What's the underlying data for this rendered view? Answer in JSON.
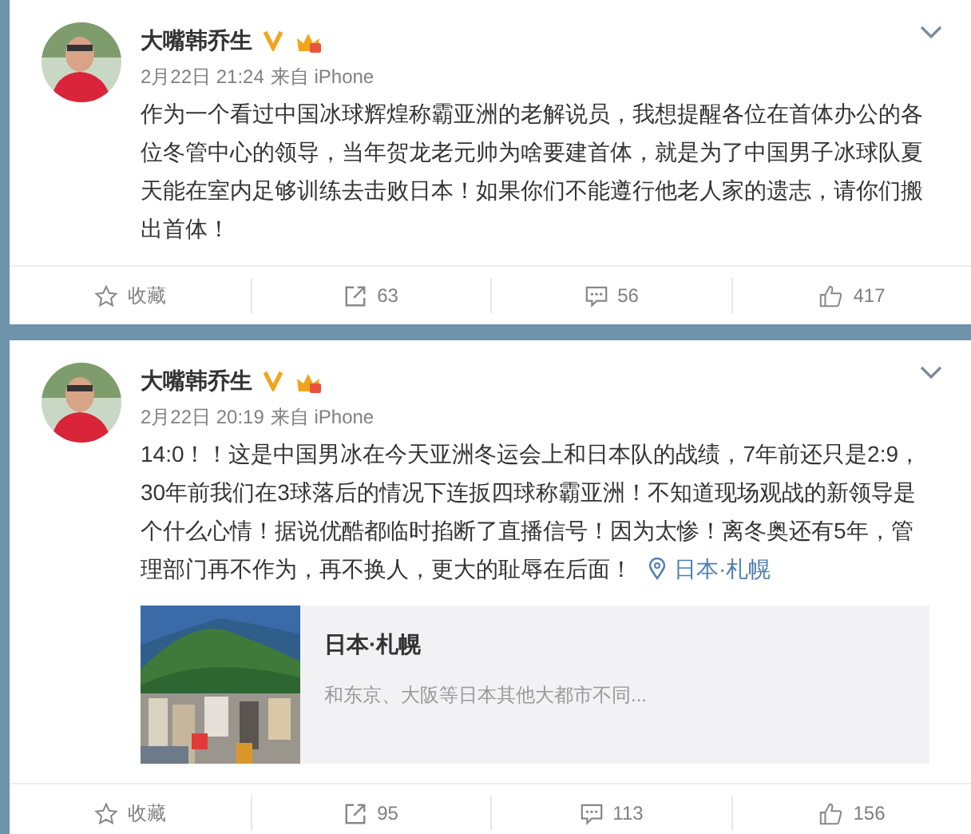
{
  "posts": [
    {
      "author": "大嘴韩乔生",
      "verified": true,
      "time": "2月22日 21:24",
      "source": "来自 iPhone",
      "text": "作为一个看过中国冰球辉煌称霸亚洲的老解说员，我想提醒各位在首体办公的各位冬管中心的领导，当年贺龙老元帅为啥要建首体，就是为了中国男子冰球队夏天能在室内足够训练去击败日本！如果你们不能遵行他老人家的遗志，请你们搬出首体！",
      "actions": {
        "favorite": "收藏",
        "reposts": "63",
        "comments": "56",
        "likes": "417"
      }
    },
    {
      "author": "大嘴韩乔生",
      "verified": true,
      "time": "2月22日 20:19",
      "source": "来自 iPhone",
      "text": "14:0！！这是中国男冰在今天亚洲冬运会上和日本队的战绩，7年前还只是2:9，30年前我们在3球落后的情况下连扳四球称霸亚洲！不知道现场观战的新领导是个什么心情！据说优酷都临时掐断了直播信号！因为太惨！离冬奥还有5年，管理部门再不作为，再不换人，更大的耻辱在后面！",
      "location": "日本·札幌",
      "place_card": {
        "kind": "picture",
        "title": "日本·札幌",
        "summary": "和东京、大阪等日本其他大都市不同..."
      },
      "actions": {
        "favorite": "收藏",
        "reposts": "95",
        "comments": "113",
        "likes": "156"
      }
    }
  ]
}
